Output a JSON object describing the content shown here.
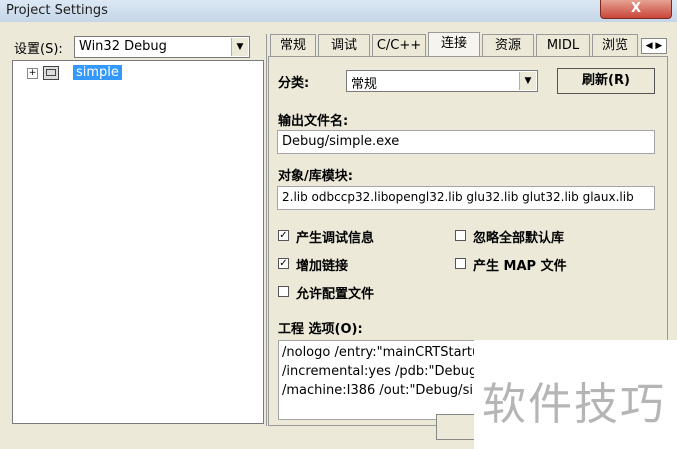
{
  "window": {
    "title": "Project Settings",
    "help": "?",
    "close": "X"
  },
  "left": {
    "settings_label": "设置(S):",
    "settings_value": "Win32 Debug",
    "tree": {
      "expander": "+",
      "selected_item": "simple"
    }
  },
  "tabs": [
    "常规",
    "调试",
    "C/C++",
    "连接",
    "资源",
    "MIDL",
    "浏览"
  ],
  "tab_arrows": "◀ ▶",
  "panel": {
    "category_label": "分类:",
    "category_value": "常规",
    "refresh_button": "刷新(R)",
    "output_label": "输出文件名:",
    "output_value": "Debug/simple.exe",
    "modules_label": "对象/库模块:",
    "modules_value": "2.lib odbccp32.libopengl32.lib glu32.lib glut32.lib glaux.lib",
    "checkboxes": [
      {
        "label": "产生调试信息",
        "checked": true
      },
      {
        "label": "忽略全部默认库",
        "checked": false
      },
      {
        "label": "增加链接",
        "checked": true
      },
      {
        "label": "产生 MAP 文件",
        "checked": false
      },
      {
        "label": "允许配置文件",
        "checked": false
      }
    ],
    "options_label": "工程 选项(O):",
    "options_lines": [
      "/nologo /entry:\"mainCRTStartu",
      "/incremental:yes /pdb:\"Debug/",
      "/machine:I386 /out:\"Debug/sim"
    ]
  },
  "watermark": "软件技巧",
  "check_mark": "✓"
}
